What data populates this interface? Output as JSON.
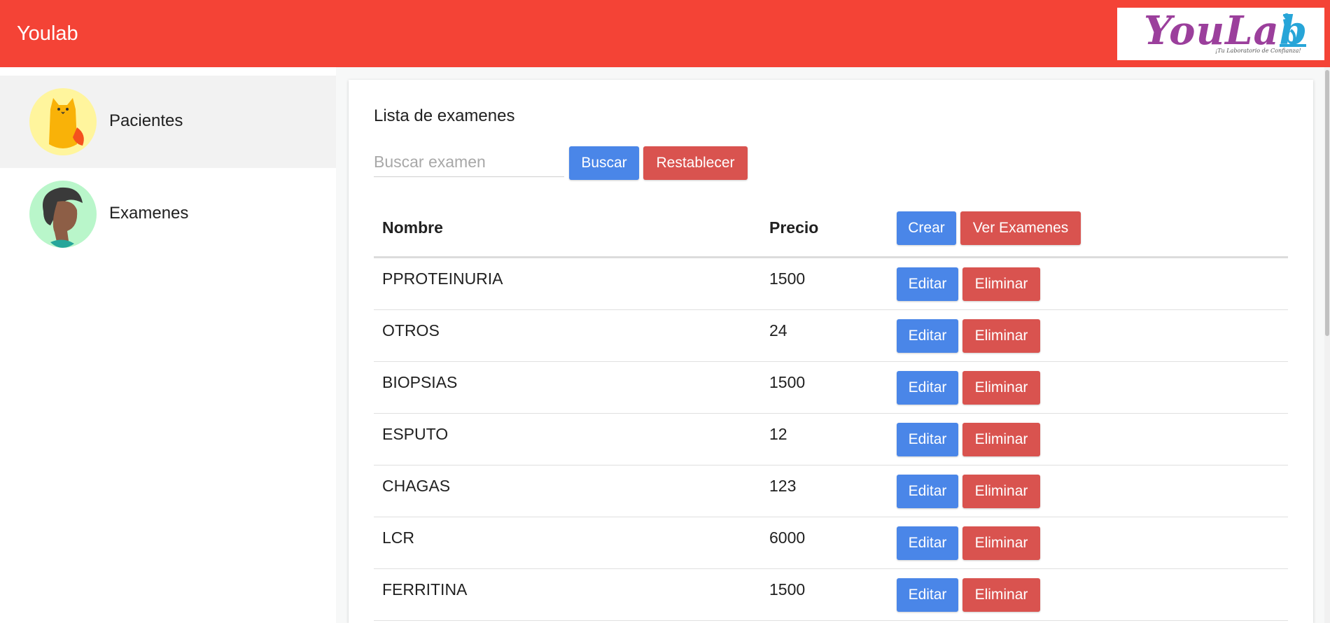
{
  "app": {
    "title": "Youlab"
  },
  "logo": {
    "text_main": "YouLa",
    "text_end": "b",
    "tagline": "¡Tu Laboratorio de Confianza!"
  },
  "sidebar": {
    "items": [
      {
        "label": "Pacientes",
        "active": true
      },
      {
        "label": "Examenes",
        "active": false
      }
    ]
  },
  "main": {
    "title": "Lista de examenes",
    "search": {
      "placeholder": "Buscar examen",
      "value": ""
    },
    "buttons": {
      "search": "Buscar",
      "reset": "Restablecer",
      "create": "Crear",
      "view": "Ver Examenes"
    },
    "table": {
      "columns": [
        "Nombre",
        "Precio"
      ],
      "row_actions": {
        "edit": "Editar",
        "delete": "Eliminar"
      },
      "rows": [
        {
          "name": "PPROTEINURIA",
          "price": "1500"
        },
        {
          "name": "OTROS",
          "price": "24"
        },
        {
          "name": "BIOPSIAS",
          "price": "1500"
        },
        {
          "name": "ESPUTO",
          "price": "12"
        },
        {
          "name": "CHAGAS",
          "price": "123"
        },
        {
          "name": "LCR",
          "price": "6000"
        },
        {
          "name": "FERRITINA",
          "price": "1500"
        }
      ]
    }
  },
  "colors": {
    "topbar": "#f44336",
    "primary_button": "#4a86e8",
    "danger_button": "#d9534f",
    "logo_purple": "#9b3f9c",
    "logo_blue": "#27a5d8"
  }
}
